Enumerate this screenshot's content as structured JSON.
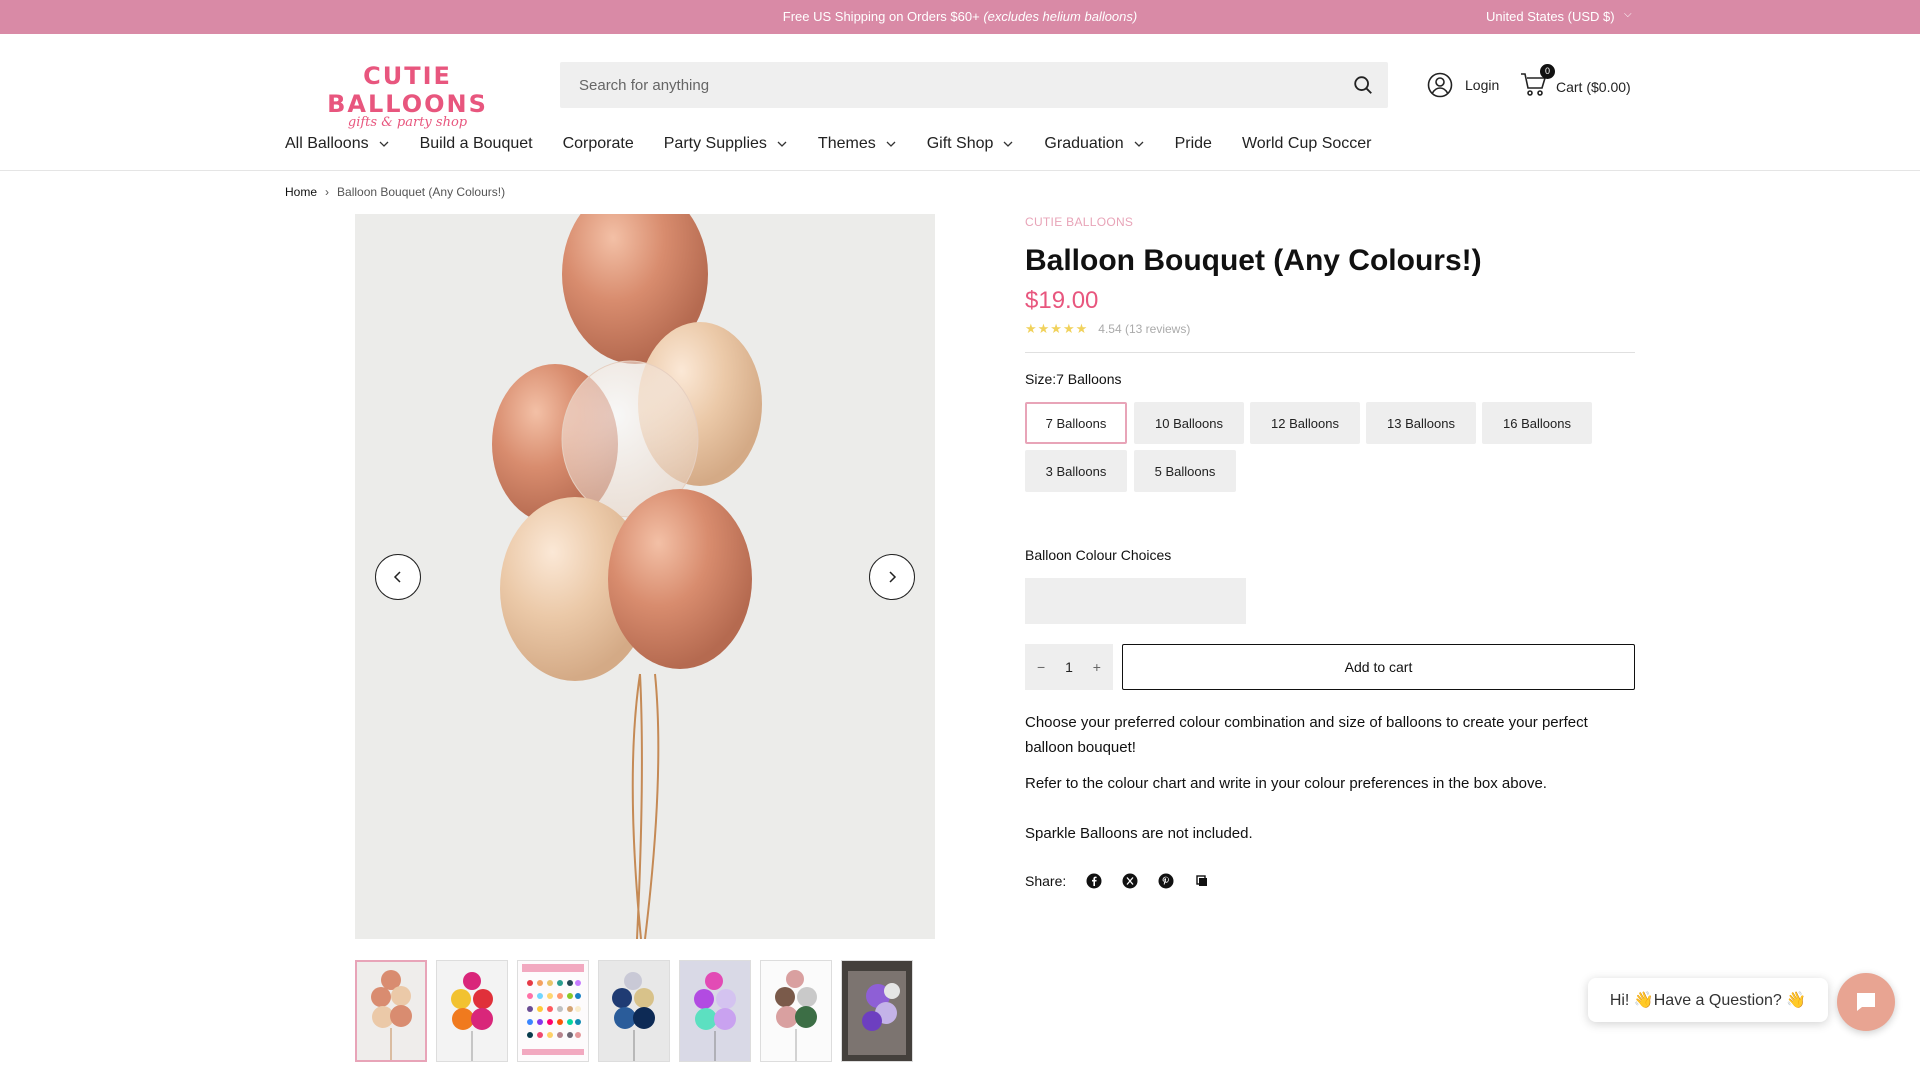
{
  "announcement": {
    "text": "Free US Shipping on Orders $60+",
    "italic": "(excludes helium balloons)",
    "region": "United States (USD $)"
  },
  "header": {
    "logo_main": "CUTIE BALLOONS",
    "logo_sub": "gifts & party shop",
    "search_placeholder": "Search for anything",
    "login": "Login",
    "cart_label": "Cart ($0.00)",
    "cart_count": "0"
  },
  "nav": [
    {
      "label": "All Balloons",
      "dropdown": true
    },
    {
      "label": "Build a Bouquet",
      "dropdown": false
    },
    {
      "label": "Corporate",
      "dropdown": false
    },
    {
      "label": "Party Supplies",
      "dropdown": true
    },
    {
      "label": "Themes",
      "dropdown": true
    },
    {
      "label": "Gift Shop",
      "dropdown": true
    },
    {
      "label": "Graduation",
      "dropdown": true
    },
    {
      "label": "Pride",
      "dropdown": false
    },
    {
      "label": "World Cup Soccer",
      "dropdown": false
    }
  ],
  "breadcrumb": {
    "home": "Home",
    "current": "Balloon Bouquet (Any Colours!)"
  },
  "product": {
    "brand": "CUTIE BALLOONS",
    "title": "Balloon Bouquet (Any Colours!)",
    "price": "$19.00",
    "stars": "★★★★★",
    "rating_text": "4.54 (13 reviews)",
    "size_label": "Size:",
    "size_selected": "7 Balloons",
    "sizes": [
      "7 Balloons",
      "10 Balloons",
      "12 Balloons",
      "13 Balloons",
      "16 Balloons",
      "3 Balloons",
      "5 Balloons"
    ],
    "colour_label": "Balloon Colour Choices",
    "quantity": "1",
    "add_to_cart": "Add to cart",
    "desc1": "Choose your preferred colour combination and size of balloons to create your perfect balloon bouquet!",
    "desc2": "Refer to the colour chart and write in your colour preferences in the box above.",
    "desc3": "Sparkle Balloons are not included.",
    "share_label": "Share:"
  },
  "chat": {
    "bubble": "Hi! 👋Have a Question? 👋"
  },
  "colors": {
    "accent": "#e8567e",
    "pink_bar": "#d98aa6",
    "selected_border": "#e8a4b8"
  }
}
